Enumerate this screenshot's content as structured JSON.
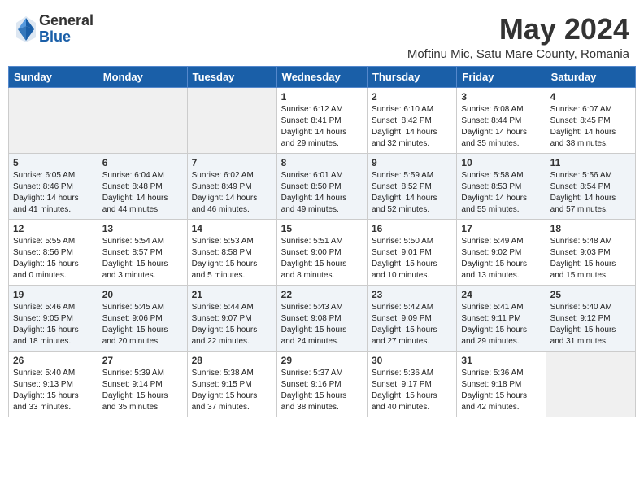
{
  "header": {
    "logo_general": "General",
    "logo_blue": "Blue",
    "month_year": "May 2024",
    "location": "Moftinu Mic, Satu Mare County, Romania"
  },
  "days_of_week": [
    "Sunday",
    "Monday",
    "Tuesday",
    "Wednesday",
    "Thursday",
    "Friday",
    "Saturday"
  ],
  "weeks": [
    [
      {
        "day": "",
        "info": ""
      },
      {
        "day": "",
        "info": ""
      },
      {
        "day": "",
        "info": ""
      },
      {
        "day": "1",
        "info": "Sunrise: 6:12 AM\nSunset: 8:41 PM\nDaylight: 14 hours\nand 29 minutes."
      },
      {
        "day": "2",
        "info": "Sunrise: 6:10 AM\nSunset: 8:42 PM\nDaylight: 14 hours\nand 32 minutes."
      },
      {
        "day": "3",
        "info": "Sunrise: 6:08 AM\nSunset: 8:44 PM\nDaylight: 14 hours\nand 35 minutes."
      },
      {
        "day": "4",
        "info": "Sunrise: 6:07 AM\nSunset: 8:45 PM\nDaylight: 14 hours\nand 38 minutes."
      }
    ],
    [
      {
        "day": "5",
        "info": "Sunrise: 6:05 AM\nSunset: 8:46 PM\nDaylight: 14 hours\nand 41 minutes."
      },
      {
        "day": "6",
        "info": "Sunrise: 6:04 AM\nSunset: 8:48 PM\nDaylight: 14 hours\nand 44 minutes."
      },
      {
        "day": "7",
        "info": "Sunrise: 6:02 AM\nSunset: 8:49 PM\nDaylight: 14 hours\nand 46 minutes."
      },
      {
        "day": "8",
        "info": "Sunrise: 6:01 AM\nSunset: 8:50 PM\nDaylight: 14 hours\nand 49 minutes."
      },
      {
        "day": "9",
        "info": "Sunrise: 5:59 AM\nSunset: 8:52 PM\nDaylight: 14 hours\nand 52 minutes."
      },
      {
        "day": "10",
        "info": "Sunrise: 5:58 AM\nSunset: 8:53 PM\nDaylight: 14 hours\nand 55 minutes."
      },
      {
        "day": "11",
        "info": "Sunrise: 5:56 AM\nSunset: 8:54 PM\nDaylight: 14 hours\nand 57 minutes."
      }
    ],
    [
      {
        "day": "12",
        "info": "Sunrise: 5:55 AM\nSunset: 8:56 PM\nDaylight: 15 hours\nand 0 minutes."
      },
      {
        "day": "13",
        "info": "Sunrise: 5:54 AM\nSunset: 8:57 PM\nDaylight: 15 hours\nand 3 minutes."
      },
      {
        "day": "14",
        "info": "Sunrise: 5:53 AM\nSunset: 8:58 PM\nDaylight: 15 hours\nand 5 minutes."
      },
      {
        "day": "15",
        "info": "Sunrise: 5:51 AM\nSunset: 9:00 PM\nDaylight: 15 hours\nand 8 minutes."
      },
      {
        "day": "16",
        "info": "Sunrise: 5:50 AM\nSunset: 9:01 PM\nDaylight: 15 hours\nand 10 minutes."
      },
      {
        "day": "17",
        "info": "Sunrise: 5:49 AM\nSunset: 9:02 PM\nDaylight: 15 hours\nand 13 minutes."
      },
      {
        "day": "18",
        "info": "Sunrise: 5:48 AM\nSunset: 9:03 PM\nDaylight: 15 hours\nand 15 minutes."
      }
    ],
    [
      {
        "day": "19",
        "info": "Sunrise: 5:46 AM\nSunset: 9:05 PM\nDaylight: 15 hours\nand 18 minutes."
      },
      {
        "day": "20",
        "info": "Sunrise: 5:45 AM\nSunset: 9:06 PM\nDaylight: 15 hours\nand 20 minutes."
      },
      {
        "day": "21",
        "info": "Sunrise: 5:44 AM\nSunset: 9:07 PM\nDaylight: 15 hours\nand 22 minutes."
      },
      {
        "day": "22",
        "info": "Sunrise: 5:43 AM\nSunset: 9:08 PM\nDaylight: 15 hours\nand 24 minutes."
      },
      {
        "day": "23",
        "info": "Sunrise: 5:42 AM\nSunset: 9:09 PM\nDaylight: 15 hours\nand 27 minutes."
      },
      {
        "day": "24",
        "info": "Sunrise: 5:41 AM\nSunset: 9:11 PM\nDaylight: 15 hours\nand 29 minutes."
      },
      {
        "day": "25",
        "info": "Sunrise: 5:40 AM\nSunset: 9:12 PM\nDaylight: 15 hours\nand 31 minutes."
      }
    ],
    [
      {
        "day": "26",
        "info": "Sunrise: 5:40 AM\nSunset: 9:13 PM\nDaylight: 15 hours\nand 33 minutes."
      },
      {
        "day": "27",
        "info": "Sunrise: 5:39 AM\nSunset: 9:14 PM\nDaylight: 15 hours\nand 35 minutes."
      },
      {
        "day": "28",
        "info": "Sunrise: 5:38 AM\nSunset: 9:15 PM\nDaylight: 15 hours\nand 37 minutes."
      },
      {
        "day": "29",
        "info": "Sunrise: 5:37 AM\nSunset: 9:16 PM\nDaylight: 15 hours\nand 38 minutes."
      },
      {
        "day": "30",
        "info": "Sunrise: 5:36 AM\nSunset: 9:17 PM\nDaylight: 15 hours\nand 40 minutes."
      },
      {
        "day": "31",
        "info": "Sunrise: 5:36 AM\nSunset: 9:18 PM\nDaylight: 15 hours\nand 42 minutes."
      },
      {
        "day": "",
        "info": ""
      }
    ]
  ]
}
